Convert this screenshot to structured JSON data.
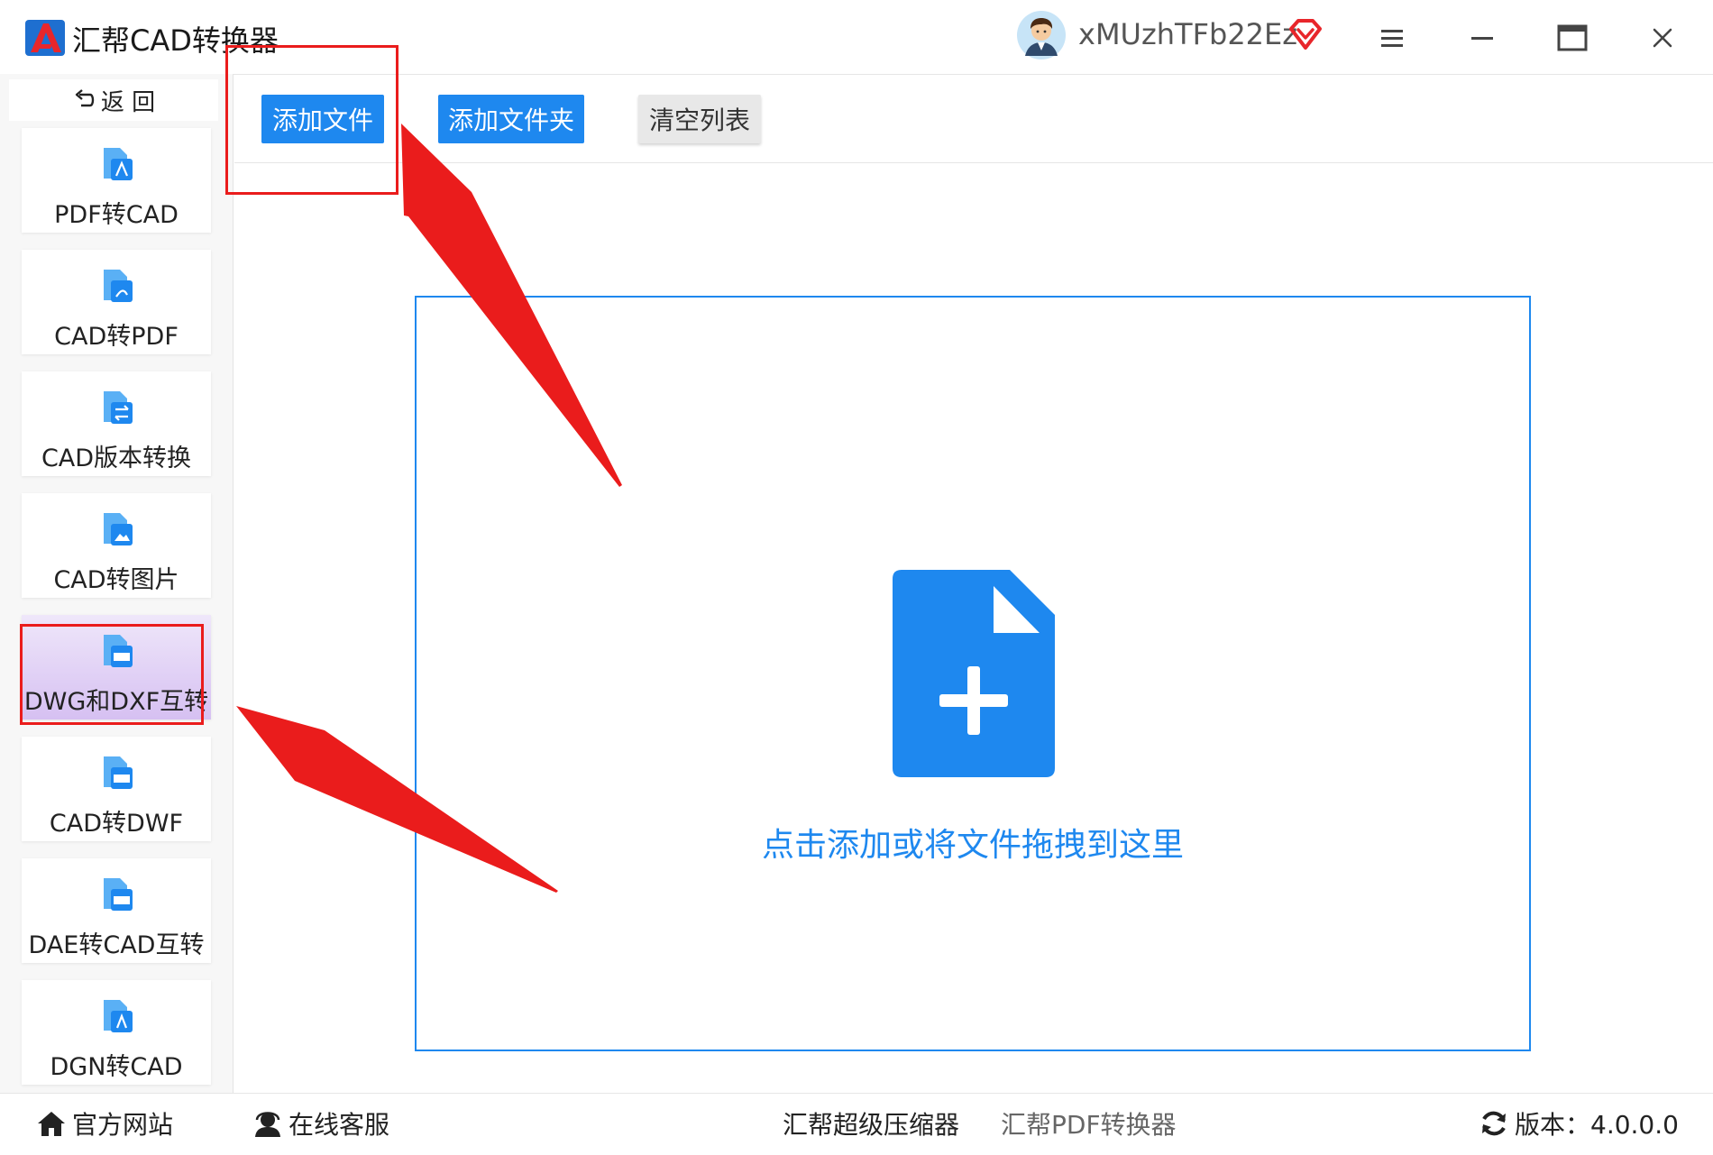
{
  "app": {
    "title": "汇帮CAD转换器",
    "username": "xMUzhTFb22Ez"
  },
  "colors": {
    "accent": "#1e88ef",
    "annotation_red": "#ea1c1c",
    "active_nav": "#d6c0f2"
  },
  "sidebar": {
    "back_label": "返 回",
    "items": [
      {
        "label": "PDF转CAD",
        "icon": "pdf-to-cad-icon"
      },
      {
        "label": "CAD转PDF",
        "icon": "cad-to-pdf-icon"
      },
      {
        "label": "CAD版本转换",
        "icon": "cad-version-icon"
      },
      {
        "label": "CAD转图片",
        "icon": "cad-to-image-icon"
      },
      {
        "label": "DWG和DXF互转",
        "icon": "dwg-dxf-icon",
        "active": true
      },
      {
        "label": "CAD转DWF",
        "icon": "cad-to-dwf-icon"
      },
      {
        "label": "DAE转CAD互转",
        "icon": "dae-to-cad-icon"
      },
      {
        "label": "DGN转CAD",
        "icon": "dgn-to-cad-icon"
      }
    ]
  },
  "toolbar": {
    "add_file": "添加文件",
    "add_folder": "添加文件夹",
    "clear_list": "清空列表"
  },
  "dropzone": {
    "hint": "点击添加或将文件拖拽到这里"
  },
  "statusbar": {
    "official_site": "官方网站",
    "online_service": "在线客服",
    "compressor": "汇帮超级压缩器",
    "pdf_converter": "汇帮PDF转换器",
    "version": "版本：4.0.0.0"
  }
}
